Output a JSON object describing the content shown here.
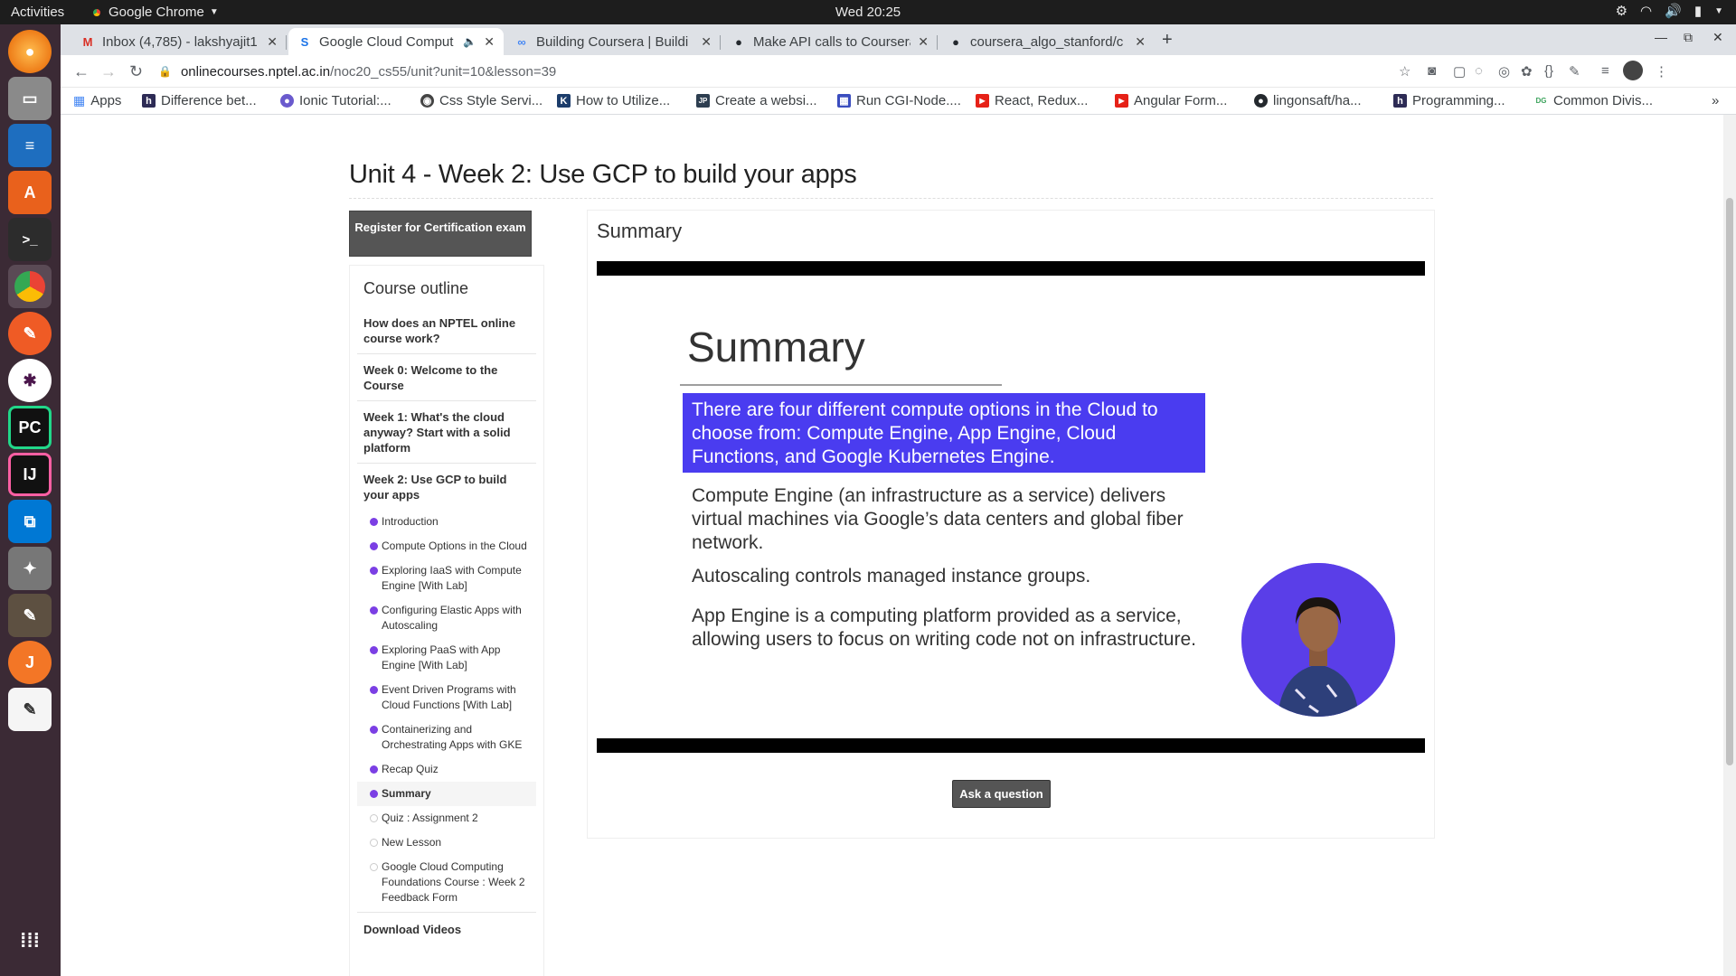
{
  "topbar": {
    "activities": "Activities",
    "app_name": "Google Chrome",
    "clock": "Wed 20:25"
  },
  "tabs": [
    {
      "title": "Inbox (4,785) - lakshyajit1",
      "favicon": "gmail-icon",
      "color": "#d93025",
      "glyph": "M"
    },
    {
      "title": "Google Cloud Comput",
      "favicon": "swayam-icon",
      "color": "#1a73e8",
      "glyph": "S",
      "audio": "🔈"
    },
    {
      "title": "Building Coursera | Buildi",
      "favicon": "link-icon",
      "color": "#4285f4",
      "glyph": "∞"
    },
    {
      "title": "Make API calls to Coursera",
      "favicon": "github-icon",
      "color": "#24292e",
      "glyph": "●"
    },
    {
      "title": "coursera_algo_stanford/c",
      "favicon": "github-icon",
      "color": "#24292e",
      "glyph": "●"
    }
  ],
  "url": {
    "domain": "onlinecourses.nptel.ac.in",
    "path": "/noc20_cs55/unit?unit=10&lesson=39"
  },
  "bookmarks": [
    {
      "label": "Apps",
      "icon": "apps-grid-icon",
      "color": "#4285f4",
      "glyph": "⋮"
    },
    {
      "label": "Difference bet...",
      "icon": "h-icon",
      "color": "#2d2b55",
      "glyph": "h"
    },
    {
      "label": "Ionic Tutorial:...",
      "icon": "ionic-icon",
      "color": "#6a5acd",
      "glyph": "●"
    },
    {
      "label": "Css Style Servi...",
      "icon": "globe-icon",
      "color": "#444",
      "glyph": "◉"
    },
    {
      "label": "How to Utilize...",
      "icon": "k-icon",
      "color": "#1c3d6b",
      "glyph": "K"
    },
    {
      "label": "Create a websi...",
      "icon": "jp-icon",
      "color": "#2d3e50",
      "glyph": "JP"
    },
    {
      "label": "Run CGI-Node....",
      "icon": "calendar-icon",
      "color": "#3a4dbf",
      "glyph": "▦"
    },
    {
      "label": "React, Redux...",
      "icon": "youtube-icon",
      "color": "#e62117",
      "glyph": "▶"
    },
    {
      "label": "Angular Form...",
      "icon": "youtube-icon",
      "color": "#e62117",
      "glyph": "▶"
    },
    {
      "label": "lingonsaft/ha...",
      "icon": "github-icon",
      "color": "#24292e",
      "glyph": "●"
    },
    {
      "label": "Programming...",
      "icon": "h-icon",
      "color": "#2d2b55",
      "glyph": "h"
    },
    {
      "label": "Common Divis...",
      "icon": "dg-icon",
      "color": "#3da35d",
      "glyph": "DG"
    }
  ],
  "page": {
    "title": "Unit 4 - Week 2: Use GCP to build your apps",
    "register_button": "Register for Certification exam",
    "outline_heading": "Course outline",
    "weeks_top": [
      "How does an NPTEL online course work?",
      "Week 0: Welcome to the Course",
      "Week 1: What's the cloud anyway? Start with a solid platform",
      "Week 2: Use GCP to build your apps"
    ],
    "lessons": [
      {
        "label": "Introduction",
        "done": true
      },
      {
        "label": "Compute Options in the Cloud",
        "done": true
      },
      {
        "label": "Exploring IaaS with Compute Engine [With Lab]",
        "done": true
      },
      {
        "label": "Configuring Elastic Apps with Autoscaling",
        "done": true
      },
      {
        "label": "Exploring PaaS with App Engine [With Lab]",
        "done": true
      },
      {
        "label": "Event Driven Programs with Cloud Functions [With Lab]",
        "done": true
      },
      {
        "label": "Containerizing and Orchestrating Apps with GKE",
        "done": true
      },
      {
        "label": "Recap Quiz",
        "done": true
      },
      {
        "label": "Summary",
        "done": true,
        "current": true
      },
      {
        "label": "Quiz : Assignment 2",
        "done": false
      },
      {
        "label": "New Lesson",
        "done": false
      },
      {
        "label": "Google Cloud Computing Foundations Course : Week 2 Feedback Form",
        "done": false
      }
    ],
    "download_videos": "Download Videos",
    "lesson_heading": "Summary",
    "ask_button": "Ask a question"
  },
  "slide": {
    "title": "Summary",
    "highlight": "There are four different compute options in the Cloud to choose from: Compute Engine, App Engine, Cloud Functions, and Google Kubernetes Engine.",
    "p1": "Compute Engine (an infrastructure as a service) delivers virtual machines via Google’s data centers and global fiber network.",
    "p2": "Autoscaling controls managed instance groups.",
    "p3": "App Engine is a computing platform provided as a service, allowing users to focus on writing code not on infrastructure."
  },
  "colors": {
    "dot_done": "#7b3fe4",
    "highlight_bg": "#4a3cf0",
    "button_bg": "#555555"
  }
}
